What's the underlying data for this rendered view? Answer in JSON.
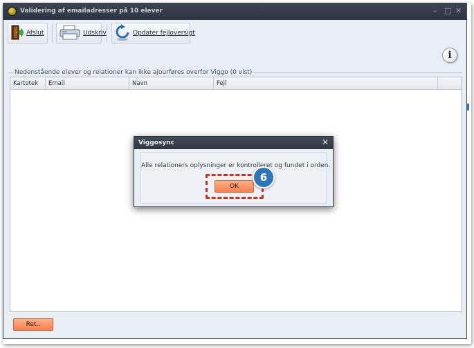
{
  "window": {
    "title": "Validering af emailadresser på 10 elever",
    "controls": [
      "–",
      "□",
      "✕"
    ]
  },
  "toolbar": {
    "afslut_label": "Afslut",
    "udskriv_label": "Udskriv",
    "opdater_label": "Opdater fejloversigt"
  },
  "group": {
    "label": "Nedenstående elever og relationer kan ikke ajourføres overfor Viggo (0 vist)"
  },
  "grid": {
    "columns": [
      "Kartotek",
      "Email",
      "Navn",
      "Fejl"
    ],
    "rows": []
  },
  "footer": {
    "ret_label": "Ret.."
  },
  "dialog": {
    "title": "Viggosync",
    "close_glyph": "✕",
    "message": "Alle relationers oplysninger er kontrolleret og fundet i orden.",
    "ok_label": "OK"
  },
  "annotation": {
    "step_number": "6"
  },
  "icons": {
    "info": "info-icon",
    "exit": "exit-door-icon",
    "print": "printer-icon",
    "refresh": "refresh-icon"
  },
  "colors": {
    "accent_orange": "#f57f4f",
    "highlight_red": "#d0301e",
    "badge_blue": "#2e76b8",
    "titlebar_dark": "#30363f"
  }
}
